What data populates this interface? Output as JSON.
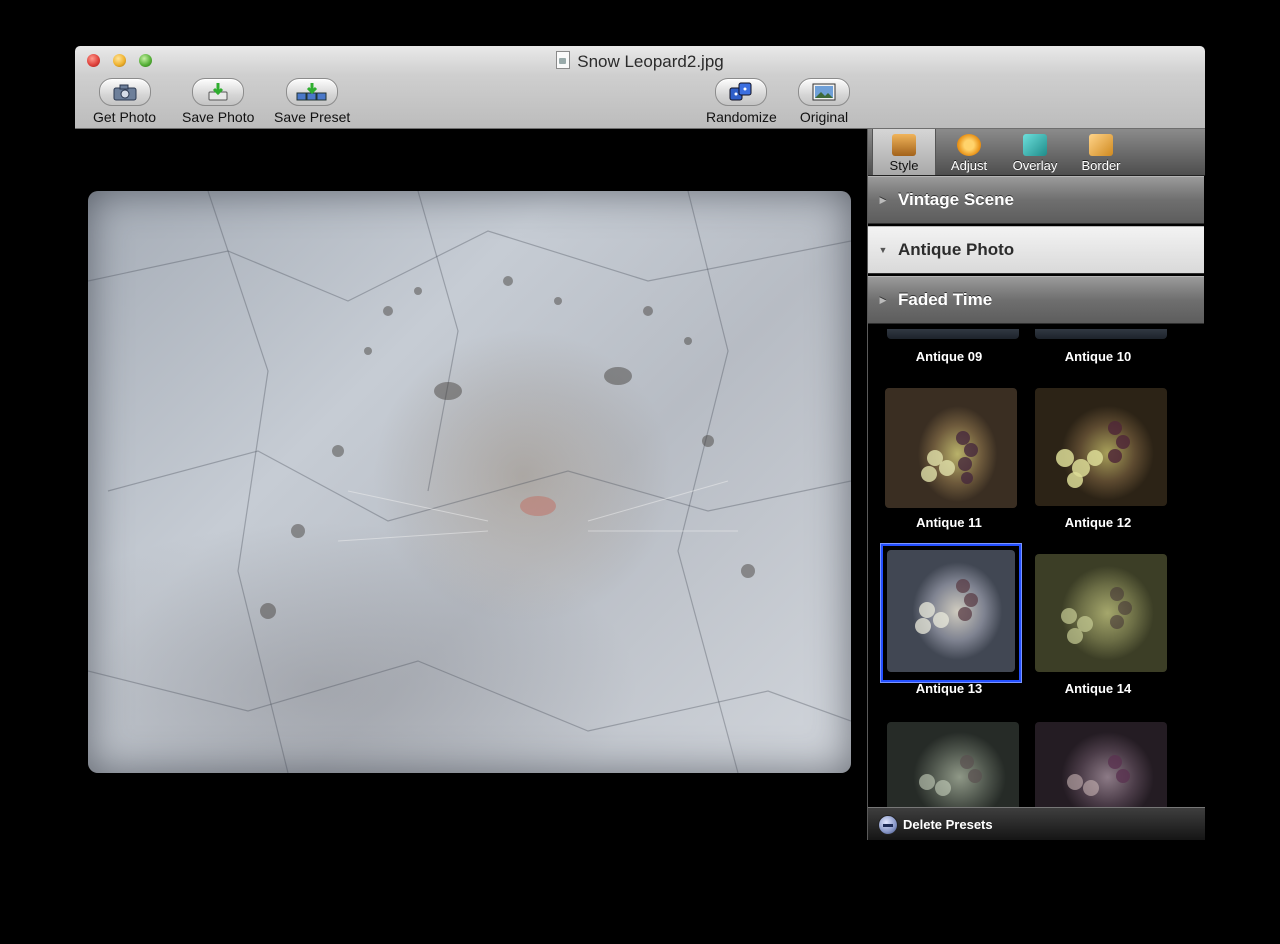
{
  "window": {
    "title": "Snow Leopard2.jpg"
  },
  "toolbar": {
    "get_photo": "Get Photo",
    "save_photo": "Save Photo",
    "save_preset": "Save Preset",
    "randomize": "Randomize",
    "original": "Original"
  },
  "panel": {
    "tabs": [
      {
        "label": "Style",
        "icon": "style-icon",
        "color": "#c98a2c"
      },
      {
        "label": "Adjust",
        "icon": "gear-icon",
        "color": "#f3a21d"
      },
      {
        "label": "Overlay",
        "icon": "overlay-icon",
        "color": "#2fb5b2"
      },
      {
        "label": "Border",
        "icon": "border-icon",
        "color": "#e8a63a"
      }
    ],
    "active_tab": "Style",
    "sections": [
      {
        "label": "Vintage Scene",
        "open": false
      },
      {
        "label": "Antique Photo",
        "open": true
      },
      {
        "label": "Faded Time",
        "open": false
      }
    ],
    "presets": [
      {
        "label": "Antique 09"
      },
      {
        "label": "Antique 10"
      },
      {
        "label": "Antique 11"
      },
      {
        "label": "Antique 12"
      },
      {
        "label": "Antique 13",
        "selected": true
      },
      {
        "label": "Antique 14"
      }
    ],
    "delete_presets": "Delete Presets"
  },
  "colors": {
    "selection": "#2450ff",
    "panel_bg": "#000000"
  }
}
